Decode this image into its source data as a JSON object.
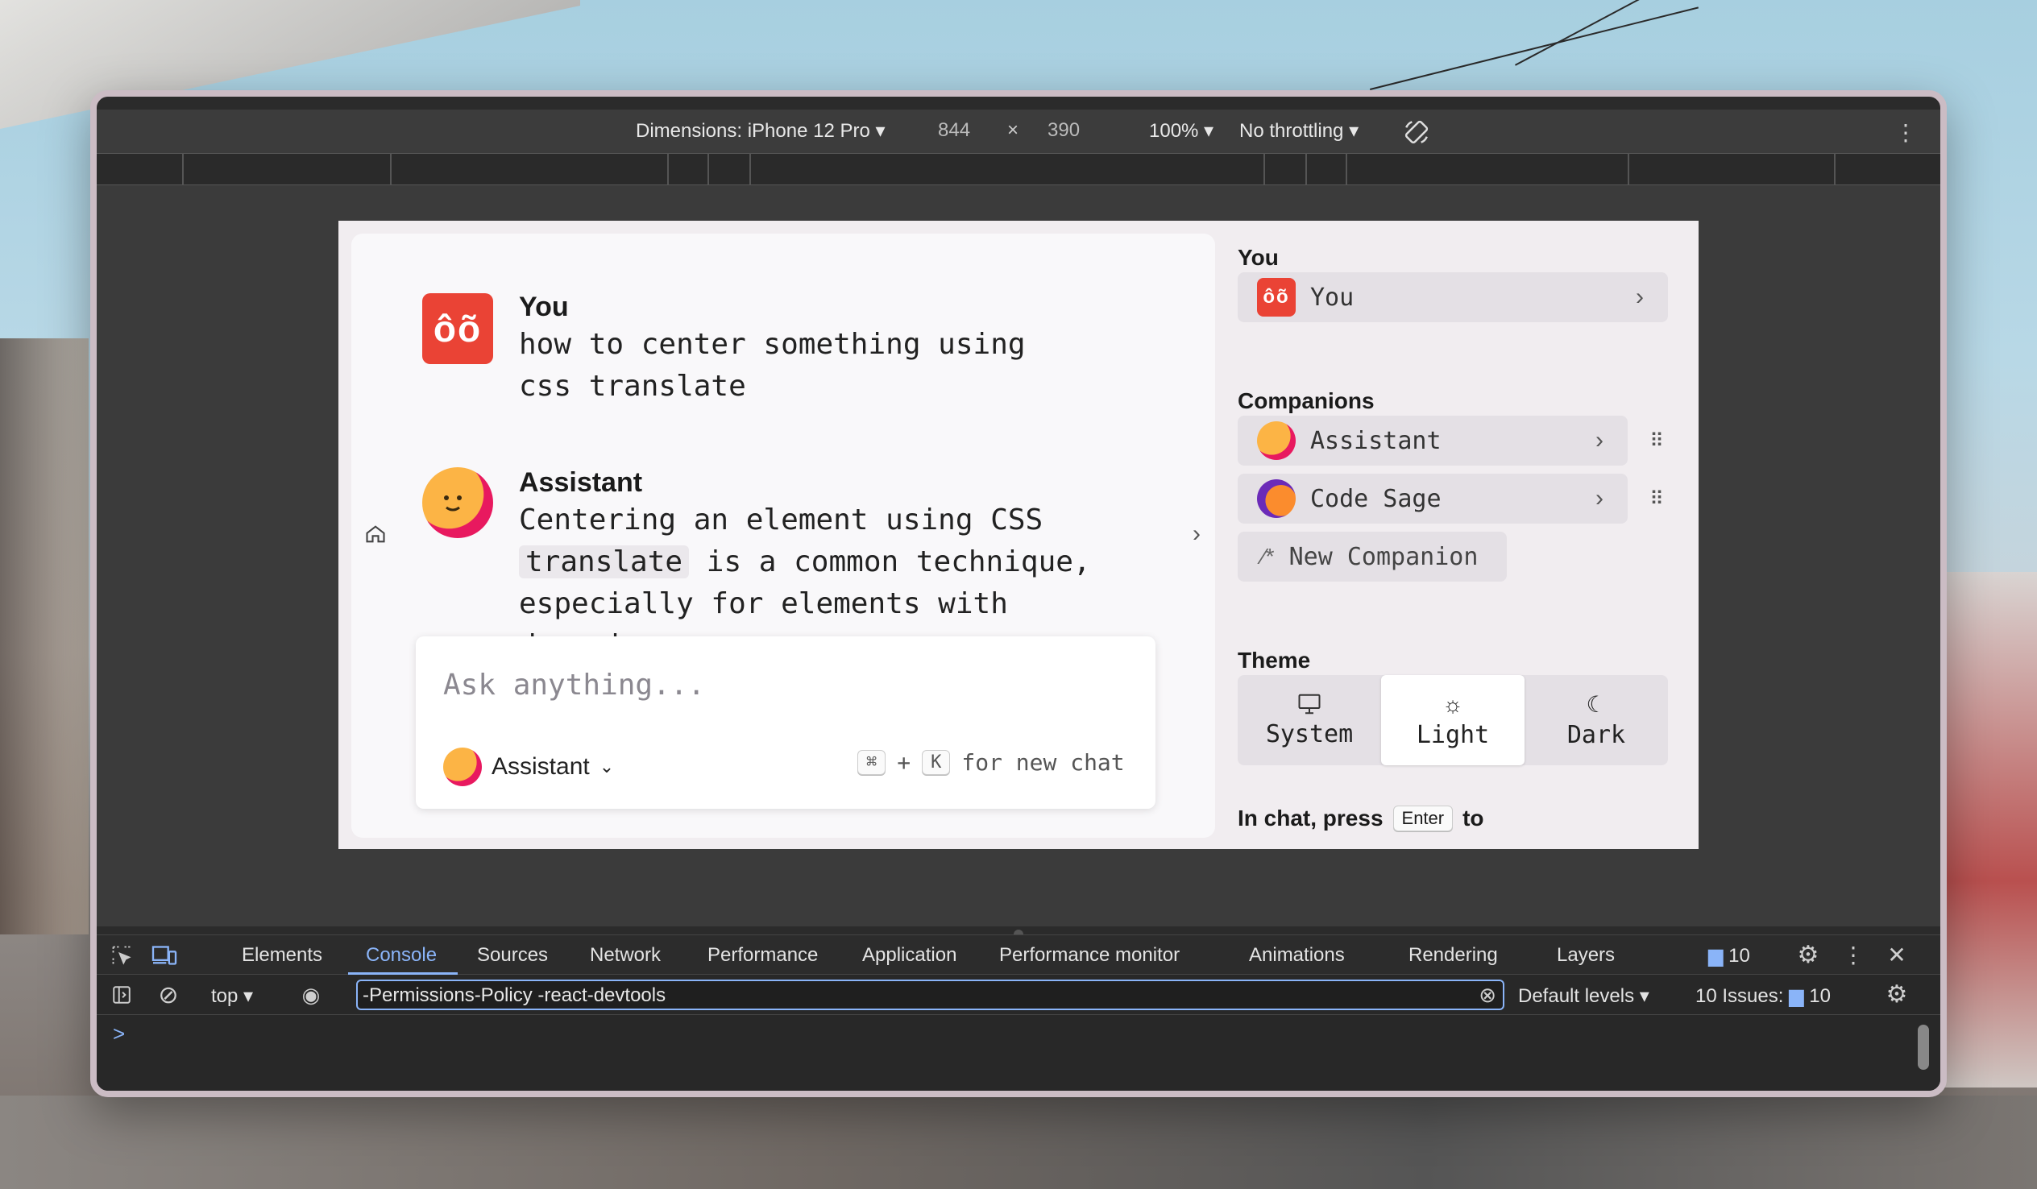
{
  "device_toolbar": {
    "dimensions_label": "Dimensions: iPhone 12 Pro",
    "width": "844",
    "times": "×",
    "height": "390",
    "zoom": "100%",
    "throttling": "No throttling",
    "rotate_icon": "rotate-icon",
    "more_icon": "more-vertical-icon"
  },
  "chat": {
    "messages": [
      {
        "author": "You",
        "avatar": "ôõ",
        "text": "how to center something using css translate"
      },
      {
        "author": "Assistant",
        "text_before": "Centering an element using CSS",
        "code": "translate",
        "text_after": "is a common technique,",
        "text_line3": "especially for elements with dynamic"
      }
    ],
    "home_icon": "home-icon",
    "next_icon": "chevron-right-icon",
    "composer": {
      "placeholder": "Ask anything...",
      "companion": "Assistant",
      "shortcut_cmd": "⌘",
      "shortcut_plus": "+",
      "shortcut_key": "K",
      "shortcut_hint": "for new chat"
    }
  },
  "sidebar": {
    "you_heading": "You",
    "you_item": {
      "avatar": "ôõ",
      "label": "You"
    },
    "companions_heading": "Companions",
    "companions": [
      {
        "label": "Assistant"
      },
      {
        "label": "Code Sage"
      }
    ],
    "new_companion": "New Companion",
    "theme_heading": "Theme",
    "theme_options": [
      {
        "label": "System",
        "icon": "monitor-icon"
      },
      {
        "label": "Light",
        "icon": "sun-icon"
      },
      {
        "label": "Dark",
        "icon": "moon-icon"
      }
    ],
    "hint_before": "In chat, press",
    "hint_key": "Enter",
    "hint_after": "to"
  },
  "devtools": {
    "tabs": [
      "Elements",
      "Console",
      "Sources",
      "Network",
      "Performance",
      "Application",
      "Performance monitor",
      "Animations",
      "Rendering",
      "Layers"
    ],
    "active_tab": "Console",
    "issues_count": "10",
    "context": "top",
    "filter_value": "-Permissions-Policy -react-devtools",
    "levels": "Default levels",
    "issues_label": "10 Issues:",
    "issues_badge": "10",
    "prompt": ">"
  },
  "colors": {
    "accent": "#8ab4f8",
    "you_avatar": "#ea4335",
    "assistant_sun": "#fcb445",
    "assistant_shadow": "#e8195f"
  }
}
